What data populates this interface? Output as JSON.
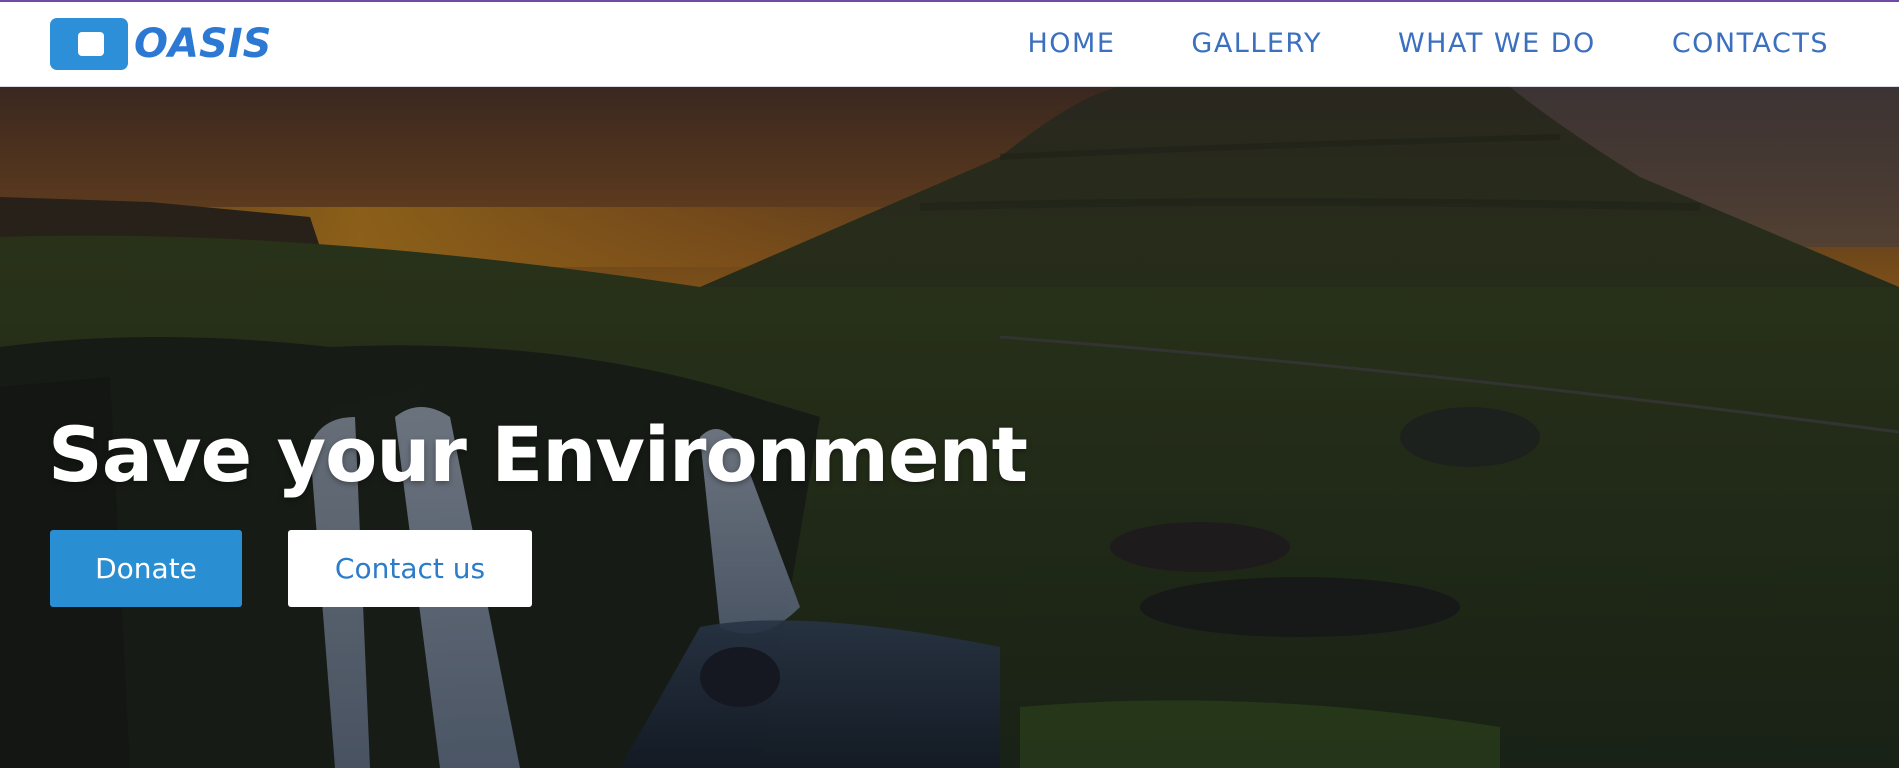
{
  "brand": {
    "name": "OASIS",
    "logo_icon": "square-logo-icon",
    "color": "#2c79d3"
  },
  "nav": {
    "items": [
      {
        "label": "HOME"
      },
      {
        "label": "GALLERY"
      },
      {
        "label": "WHAT WE DO"
      },
      {
        "label": "CONTACTS"
      }
    ],
    "color": "#3b6fbf"
  },
  "hero": {
    "title": "Save your Environment",
    "background": "waterfall-mountain-sunset-photo",
    "buttons": {
      "donate_label": "Donate",
      "contact_label": "Contact us"
    },
    "accent": "#2a8ed3"
  }
}
